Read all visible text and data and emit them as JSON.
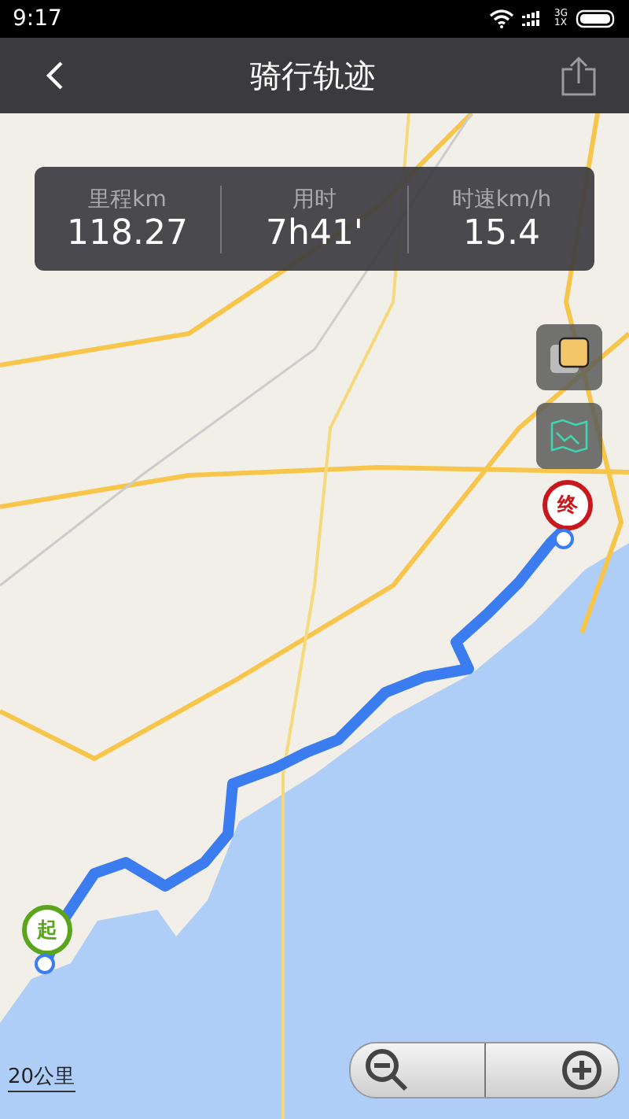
{
  "status_bar": {
    "time": "9:17",
    "network_top": "3G",
    "network_bottom": "1X"
  },
  "header": {
    "title": "骑行轨迹"
  },
  "stats": [
    {
      "label": "里程km",
      "value": "118.27"
    },
    {
      "label": "用时",
      "value": "7h41'"
    },
    {
      "label": "时速km/h",
      "value": "15.4"
    }
  ],
  "map": {
    "start_marker": "起",
    "end_marker": "终",
    "scale": "20公里"
  }
}
